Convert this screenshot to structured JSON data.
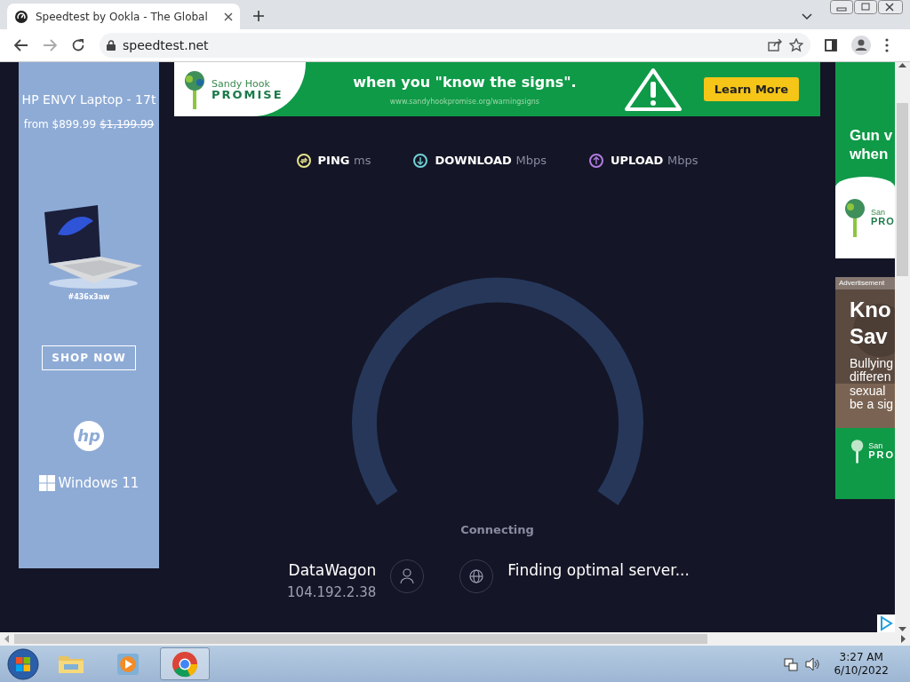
{
  "browser": {
    "tab": {
      "title": "Speedtest by Ookla - The Global",
      "selected": true
    },
    "address": "speedtest.net"
  },
  "top_banner": {
    "brand": "Sandy Hook",
    "brand_sub": "PROMISE",
    "headline": "when you \"know the signs\".",
    "url": "www.sandyhookpromise.org/warningsigns",
    "button": "Learn More"
  },
  "left_ad": {
    "title": "HP ENVY Laptop - 17t",
    "price": "from $899.99",
    "old_price": "$1,199.99",
    "sku": "#436x3aw",
    "button": "SHOP NOW",
    "logo_text": "hp",
    "os_text": "Windows 11"
  },
  "metrics": [
    {
      "label": "PING",
      "unit": "ms",
      "color": "#e5e38a"
    },
    {
      "label": "DOWNLOAD",
      "unit": "Mbps",
      "color": "#6fd2d6"
    },
    {
      "label": "UPLOAD",
      "unit": "Mbps",
      "color": "#b07ce0"
    }
  ],
  "status": "Connecting",
  "isp": {
    "name": "DataWagon",
    "ip": "104.192.2.38"
  },
  "server": "Finding optimal server...",
  "right_ads": [
    {
      "kind": "green",
      "lines": [
        "Gun v",
        "when"
      ],
      "brand": "San",
      "brand_sub": "PRO"
    },
    {
      "label": "Advertisement",
      "headline": [
        "Kno",
        "Sav"
      ],
      "lines": [
        "Bullying",
        "differen",
        "sexual",
        "be a sig"
      ],
      "brand": "San",
      "brand_sub": "PRO"
    }
  ],
  "taskbar": {
    "apps": [
      {
        "kind": "folder",
        "selected": false
      },
      {
        "kind": "media",
        "selected": false
      },
      {
        "kind": "chrome",
        "selected": true
      }
    ],
    "time": "3:27 AM",
    "date": "6/10/2022"
  }
}
